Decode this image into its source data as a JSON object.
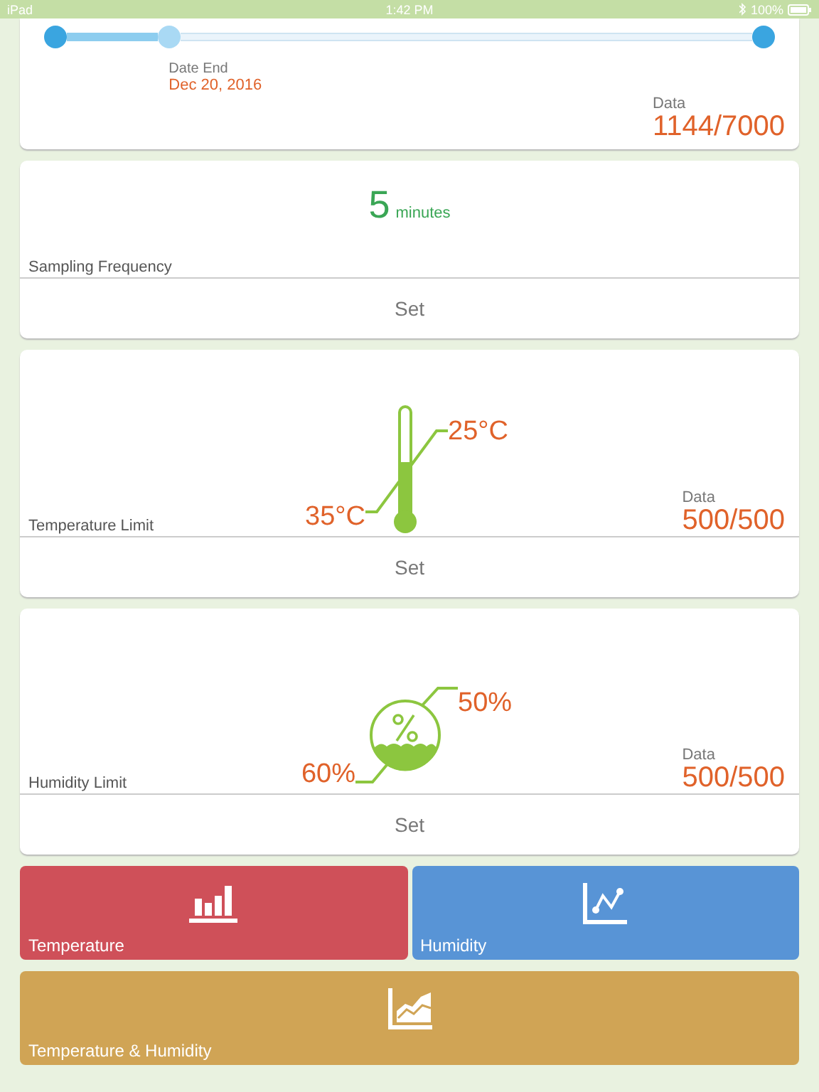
{
  "status_bar": {
    "carrier": "iPad",
    "time": "1:42 PM",
    "battery": "100%"
  },
  "range_card": {
    "slider": {
      "level": 0.16
    },
    "date_label": "Date End",
    "date_value": "Dec 20, 2016",
    "data_label": "Data",
    "data_value": "1144/7000"
  },
  "sampling_card": {
    "value": "5",
    "unit": "minutes",
    "label": "Sampling Frequency",
    "button": "Set"
  },
  "limit_cards": [
    {
      "kind": "temperature",
      "upper": "25°C",
      "lower": "35°C",
      "label": "Temperature Limit",
      "data_label": "Data",
      "data_value": "500/500",
      "button": "Set"
    },
    {
      "kind": "humidity",
      "upper": "50%",
      "lower": "60%",
      "label": "Humidity Limit",
      "data_label": "Data",
      "data_value": "500/500",
      "button": "Set"
    }
  ],
  "tiles": [
    {
      "kind": "bar",
      "label": "Temperature",
      "color": "#cf5059"
    },
    {
      "kind": "line",
      "label": "Humidity",
      "color": "#5894d6"
    },
    {
      "kind": "area",
      "label": "Temperature & Humidity",
      "color": "#d0a455"
    }
  ]
}
